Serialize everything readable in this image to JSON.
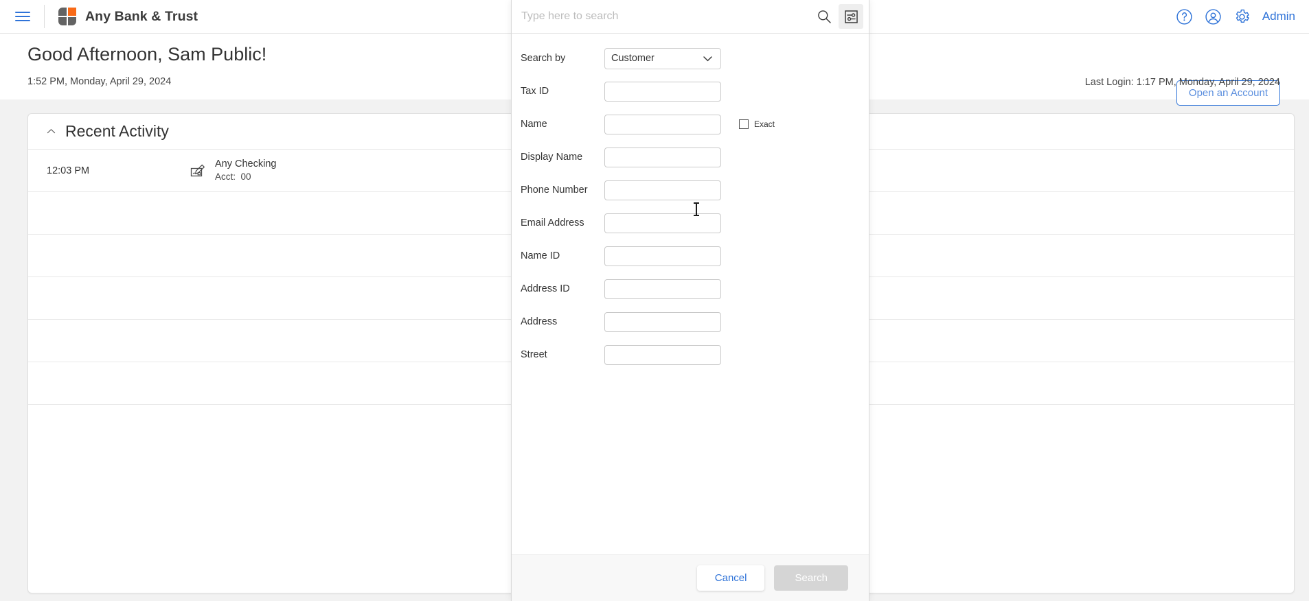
{
  "topbar": {
    "menu_icon": "hamburger-icon",
    "brand_name": "Any Bank & Trust",
    "help_icon": "help-circle-icon",
    "account_icon": "user-circle-icon",
    "settings_icon": "gear-icon",
    "admin_label": "Admin",
    "accent_blue": "#2f73d8",
    "logo_orange": "#f96a17",
    "logo_gray": "#636363"
  },
  "greeting": {
    "title": "Good Afternoon, Sam Public!",
    "timestamp": "1:52 PM, Monday, April 29, 2024",
    "open_account_label": "Open an Account",
    "last_login": "Last Login: 1:17 PM, Monday, April 29, 2024"
  },
  "recent_activity": {
    "collapse_icon": "chevron-up-icon",
    "title": "Recent Activity",
    "rows": [
      {
        "time": "12:03 PM",
        "icon": "check-write-icon",
        "account_name": "Any Checking",
        "account_label": "Acct:",
        "account_number": "00"
      }
    ],
    "empty_row_count": 5
  },
  "search_panel": {
    "search_placeholder": "Type here to search",
    "search_value": "",
    "search_icon": "magnifier-icon",
    "filter_icon": "filter-sliders-icon",
    "search_by": {
      "label": "Search by",
      "value": "Customer",
      "chevron_icon": "chevron-down-icon"
    },
    "fields": [
      {
        "label": "Tax ID",
        "value": "",
        "name": "tax-id-field"
      },
      {
        "label": "Name",
        "value": "",
        "name": "name-field"
      },
      {
        "label": "Display Name",
        "value": "",
        "name": "display-name-field"
      },
      {
        "label": "Phone Number",
        "value": "",
        "name": "phone-number-field"
      },
      {
        "label": "Email Address",
        "value": "",
        "name": "email-address-field"
      },
      {
        "label": "Name ID",
        "value": "",
        "name": "name-id-field"
      },
      {
        "label": "Address ID",
        "value": "",
        "name": "address-id-field"
      },
      {
        "label": "Address",
        "value": "",
        "name": "address-field"
      },
      {
        "label": "Street",
        "value": "",
        "name": "street-field"
      }
    ],
    "exact": {
      "label": "Exact",
      "checked": false
    },
    "footer": {
      "cancel_label": "Cancel",
      "search_label": "Search",
      "search_disabled": true
    }
  }
}
